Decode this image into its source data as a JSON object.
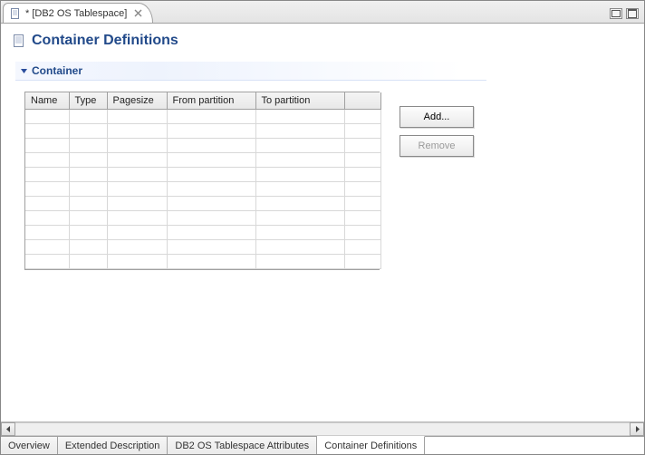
{
  "top_tab": {
    "title": "* [DB2 OS Tablespace]"
  },
  "page": {
    "heading": "Container Definitions"
  },
  "section": {
    "title": "Container"
  },
  "table": {
    "columns": {
      "name": "Name",
      "type": "Type",
      "pagesize": "Pagesize",
      "from_partition": "From partition",
      "to_partition": "To partition"
    },
    "rows": []
  },
  "buttons": {
    "add": "Add...",
    "remove": "Remove"
  },
  "bottom_tabs": {
    "overview": "Overview",
    "extended_description": "Extended Description",
    "attributes": "DB2 OS Tablespace Attributes",
    "container_definitions": "Container Definitions"
  }
}
